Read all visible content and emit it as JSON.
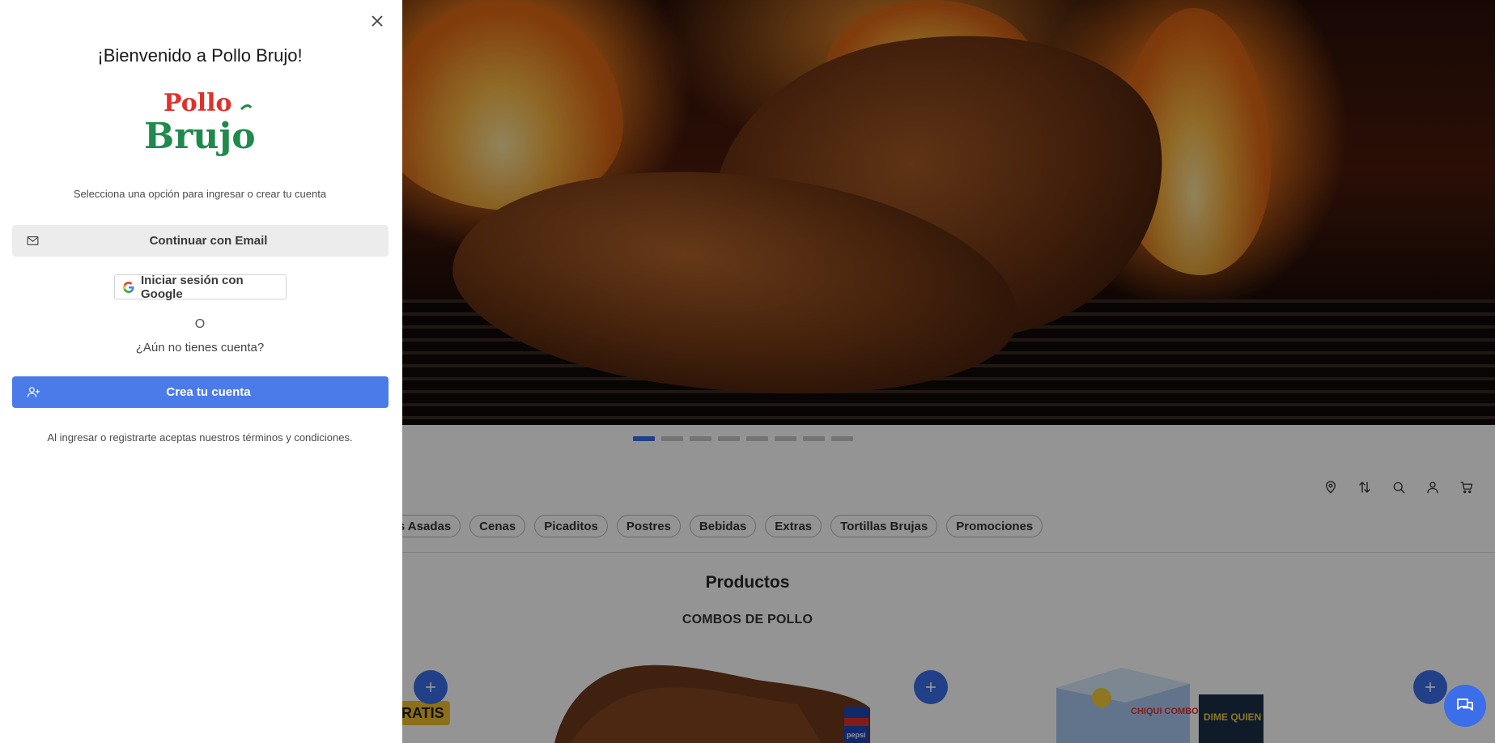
{
  "drawer": {
    "welcome_title": "¡Bienvenido a Pollo Brujo!",
    "logo": {
      "line1": "Pollo",
      "line2": "Brujo"
    },
    "subtitle": "Selecciona una opción para ingresar o crear tu cuenta",
    "email_button": "Continuar con Email",
    "google_button": "Iniciar sesión con Google",
    "separator": "O",
    "no_account": "¿Aún no tienes cuenta?",
    "create_button": "Crea tu cuenta",
    "terms": "Al ingresar o registrarte aceptas nuestros términos y condiciones."
  },
  "carousel": {
    "slide_count": 8,
    "active_index": 0
  },
  "categories": [
    "Papas Asadas",
    "Cenas",
    "Picaditos",
    "Postres",
    "Bebidas",
    "Extras",
    "Tortillas Brujas",
    "Promociones"
  ],
  "products": {
    "title": "Productos",
    "section": "COMBOS DE POLLO",
    "badge": "RATIS",
    "kid_box_text": "CHIQUI COMBO",
    "game_box_text": "DIME QUIEN",
    "pepsi_text": "pepsi"
  },
  "icons": [
    "location-icon",
    "sort-icon",
    "search-icon",
    "user-icon",
    "cart-icon",
    "chat-icon",
    "close-icon",
    "mail-icon",
    "google-icon",
    "user-plus-icon",
    "plus-icon"
  ],
  "colors": {
    "accent": "#3b6ee8",
    "create_button": "#4a7be8",
    "logo_red": "#e0312b",
    "logo_green": "#1f8a4c",
    "badge": "#f3c02d"
  }
}
